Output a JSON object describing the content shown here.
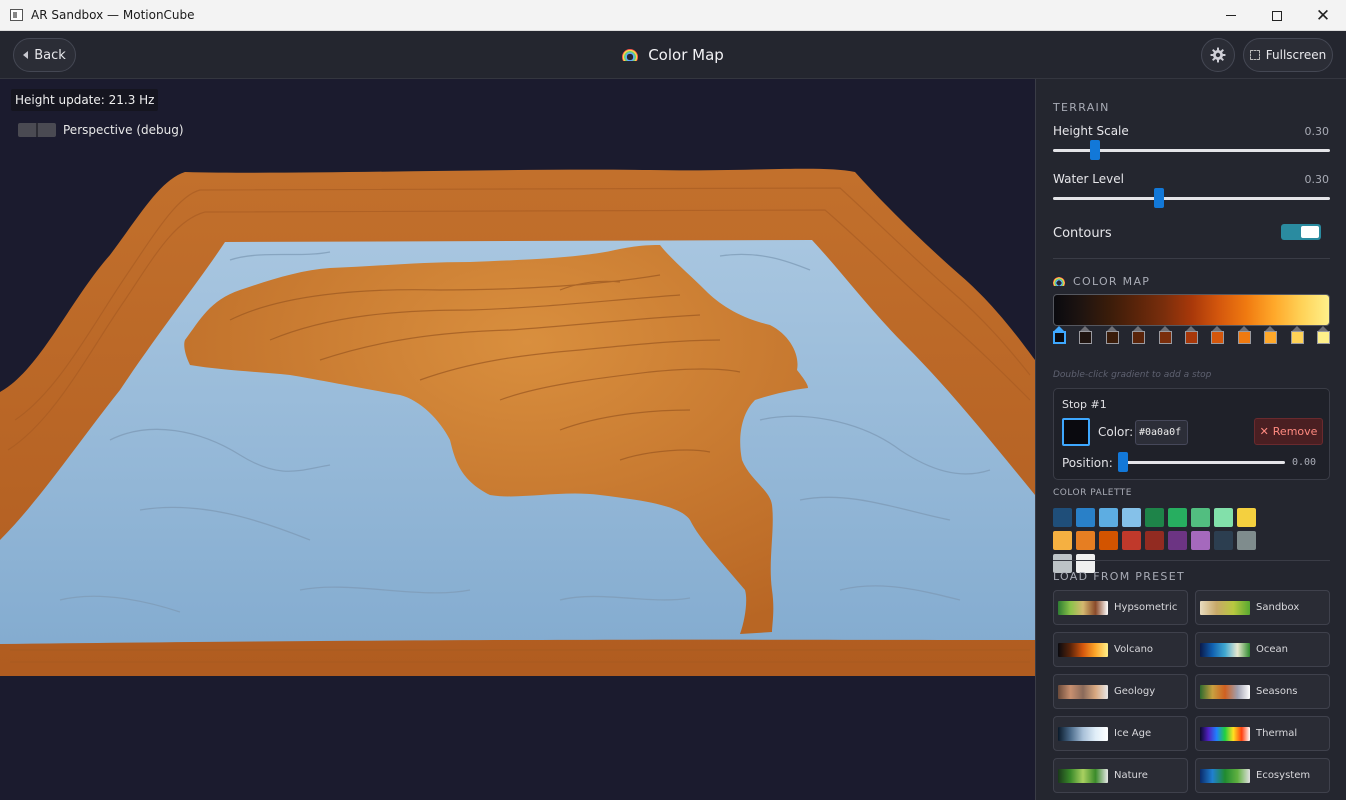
{
  "window": {
    "title": "AR Sandbox — MotionCube"
  },
  "header": {
    "back_label": "Back",
    "title": "Color Map",
    "fullscreen_label": "Fullscreen"
  },
  "viewport": {
    "height_update": "Height update: 21.3 Hz",
    "perspective_label": "Perspective (debug)"
  },
  "terrain": {
    "section": "TERRAIN",
    "height_scale": {
      "label": "Height Scale",
      "value": "0.30",
      "fraction": 0.14
    },
    "water_level": {
      "label": "Water Level",
      "value": "0.30",
      "fraction": 0.38
    },
    "contours": {
      "label": "Contours",
      "enabled": true
    }
  },
  "color_map": {
    "section": "COLOR MAP",
    "stops": [
      "#0a0a0f",
      "#1f1410",
      "#3a1c0a",
      "#5a240a",
      "#7a2e0c",
      "#a8380a",
      "#d4570d",
      "#f07a10",
      "#ffa82a",
      "#ffd257",
      "#fff08a"
    ],
    "selected_stop": 0,
    "hint": "Double-click gradient to add a stop",
    "editor": {
      "title": "Stop #1",
      "color_label": "Color:",
      "hex": "#0a0a0f",
      "remove_label": "Remove",
      "position_label": "Position:",
      "position_value": "0.00",
      "position_fraction": 0.0
    }
  },
  "palette": {
    "label": "COLOR PALETTE",
    "colors": [
      "#1f4e79",
      "#2980c8",
      "#5dade2",
      "#85c1e9",
      "#1e8449",
      "#27ae60",
      "#52be80",
      "#82e0aa",
      "#f4d03f",
      "#f5b041",
      "#e67e22",
      "#d35400",
      "#c0392b",
      "#922b21",
      "#6c3483",
      "#a569bd",
      "#2c3e50",
      "#7f8c8d",
      "#bdc3c7",
      "#f0f0f0"
    ]
  },
  "presets": {
    "label": "LOAD FROM PRESET",
    "items": [
      {
        "name": "Hypsometric",
        "gradient": [
          "#2e7d32",
          "#8bc34a",
          "#d4b870",
          "#8a4a2a",
          "#ffffff"
        ]
      },
      {
        "name": "Sandbox",
        "gradient": [
          "#e8dcc0",
          "#c8a868",
          "#b8c840",
          "#58a830"
        ]
      },
      {
        "name": "Volcano",
        "gradient": [
          "#0a0a0f",
          "#5a240a",
          "#d4570d",
          "#ffa82a",
          "#fff08a"
        ]
      },
      {
        "name": "Ocean",
        "gradient": [
          "#0a1a4a",
          "#1060b0",
          "#40a8d0",
          "#e8e8d0",
          "#2e8a2e"
        ]
      },
      {
        "name": "Geology",
        "gradient": [
          "#6a4a3a",
          "#c89070",
          "#8a6a5a",
          "#d8a880",
          "#e8e8e8"
        ]
      },
      {
        "name": "Seasons",
        "gradient": [
          "#2e6a2e",
          "#c8a040",
          "#d06020",
          "#a0a0b0",
          "#ffffff"
        ]
      },
      {
        "name": "Ice Age",
        "gradient": [
          "#0a1a2a",
          "#4a6a8a",
          "#a8c0d8",
          "#e0eef8",
          "#ffffff"
        ]
      },
      {
        "name": "Thermal",
        "gradient": [
          "#0a0a2a",
          "#5020c0",
          "#2080ff",
          "#20d040",
          "#ffe020",
          "#ff4010",
          "#ffffff"
        ]
      },
      {
        "name": "Nature",
        "gradient": [
          "#1a3a1a",
          "#3a8a2a",
          "#a8d060",
          "#3a8a2a",
          "#e8e8e8"
        ]
      },
      {
        "name": "Ecosystem",
        "gradient": [
          "#0a2a6a",
          "#2080d0",
          "#208a30",
          "#60b040",
          "#e0e0e0"
        ]
      }
    ]
  },
  "colors": {
    "accent": "#1278d8",
    "selected_outline": "#3ea8ff",
    "toggle_on": "#2a8ba0",
    "terrain_sand": "#c8782e",
    "water": "#8eb4d4"
  }
}
